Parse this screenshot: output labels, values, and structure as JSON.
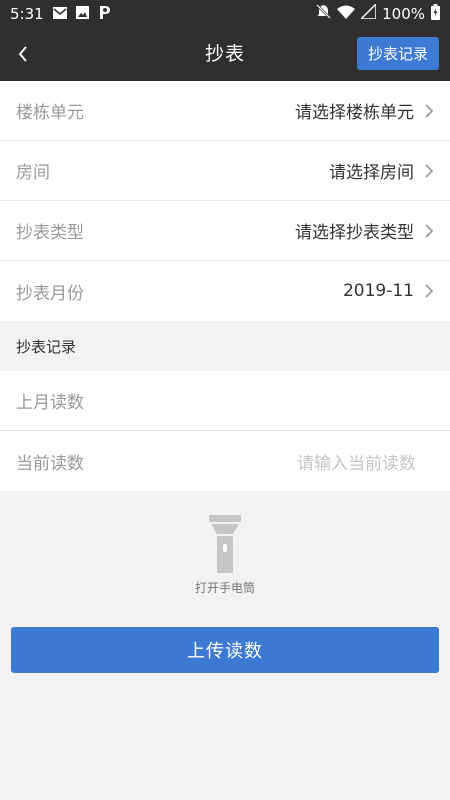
{
  "status": {
    "time": "5:31",
    "battery": "100%",
    "icons_left": [
      "mail-icon",
      "image-icon",
      "p-app-icon"
    ],
    "icons_right": [
      "bell-off-icon",
      "wifi-icon",
      "signal-icon",
      "battery-icon"
    ]
  },
  "header": {
    "title": "抄表",
    "record_button": "抄表记录"
  },
  "form": {
    "rows": [
      {
        "label": "楼栋单元",
        "value": "请选择楼栋单元"
      },
      {
        "label": "房间",
        "value": "请选择房间"
      },
      {
        "label": "抄表类型",
        "value": "请选择抄表类型"
      },
      {
        "label": "抄表月份",
        "value": "2019-11"
      }
    ]
  },
  "record_section": {
    "title": "抄表记录",
    "last_reading_label": "上月读数",
    "last_reading_value": "",
    "current_reading_label": "当前读数",
    "current_reading_placeholder": "请输入当前读数"
  },
  "torch": {
    "label": "打开手电筒"
  },
  "upload_button": "上传读数",
  "colors": {
    "header_bg": "#2f2f2f",
    "accent": "#3d7ad4",
    "page_bg": "#f2f2f2"
  }
}
